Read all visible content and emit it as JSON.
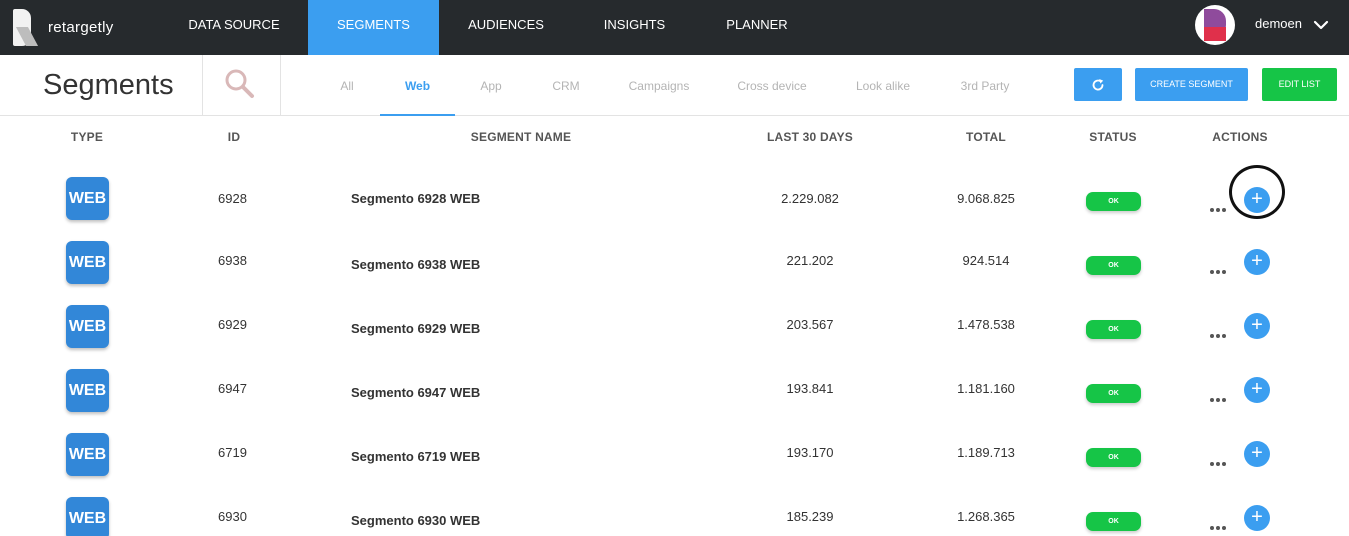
{
  "brand": {
    "name": "retargetly"
  },
  "nav": {
    "items": [
      {
        "label": "DATA SOURCE",
        "active": false
      },
      {
        "label": "SEGMENTS",
        "active": true
      },
      {
        "label": "AUDIENCES",
        "active": false
      },
      {
        "label": "INSIGHTS",
        "active": false
      },
      {
        "label": "PLANNER",
        "active": false
      }
    ],
    "user": {
      "name": "demoen"
    }
  },
  "subheader": {
    "title": "Segments",
    "tabs": [
      {
        "label": "All",
        "active": false
      },
      {
        "label": "Web",
        "active": true
      },
      {
        "label": "App",
        "active": false
      },
      {
        "label": "CRM",
        "active": false
      },
      {
        "label": "Campaigns",
        "active": false
      },
      {
        "label": "Cross device",
        "active": false
      },
      {
        "label": "Look alike",
        "active": false
      },
      {
        "label": "3rd Party",
        "active": false
      }
    ],
    "buttons": {
      "refresh_icon": "refresh-icon",
      "create_label": "CREATE SEGMENT",
      "edit_label": "EDIT LIST"
    }
  },
  "table": {
    "columns": {
      "type": "TYPE",
      "id": "ID",
      "name": "SEGMENT NAME",
      "last30": "LAST 30 DAYS",
      "total": "TOTAL",
      "status": "STATUS",
      "actions": "ACTIONS"
    },
    "rows": [
      {
        "type": "WEB",
        "id": "6928",
        "name": "Segmento 6928 WEB",
        "last30": "2.229.082",
        "total": "9.068.825",
        "status": "OK",
        "add": "+"
      },
      {
        "type": "WEB",
        "id": "6938",
        "name": "Segmento 6938 WEB",
        "last30": "221.202",
        "total": "924.514",
        "status": "OK",
        "add": "+"
      },
      {
        "type": "WEB",
        "id": "6929",
        "name": "Segmento 6929 WEB",
        "last30": "203.567",
        "total": "1.478.538",
        "status": "OK",
        "add": "+"
      },
      {
        "type": "WEB",
        "id": "6947",
        "name": "Segmento 6947 WEB",
        "last30": "193.841",
        "total": "1.181.160",
        "status": "OK",
        "add": "+"
      },
      {
        "type": "WEB",
        "id": "6719",
        "name": "Segmento 6719 WEB",
        "last30": "193.170",
        "total": "1.189.713",
        "status": "OK",
        "add": "+"
      },
      {
        "type": "WEB",
        "id": "6930",
        "name": "Segmento 6930 WEB",
        "last30": "185.239",
        "total": "1.268.365",
        "status": "OK",
        "add": "+"
      }
    ]
  },
  "colors": {
    "nav_bg": "#262a2d",
    "accent_blue": "#3b9ef0",
    "badge_blue": "#3287d8",
    "success_green": "#16c547"
  }
}
